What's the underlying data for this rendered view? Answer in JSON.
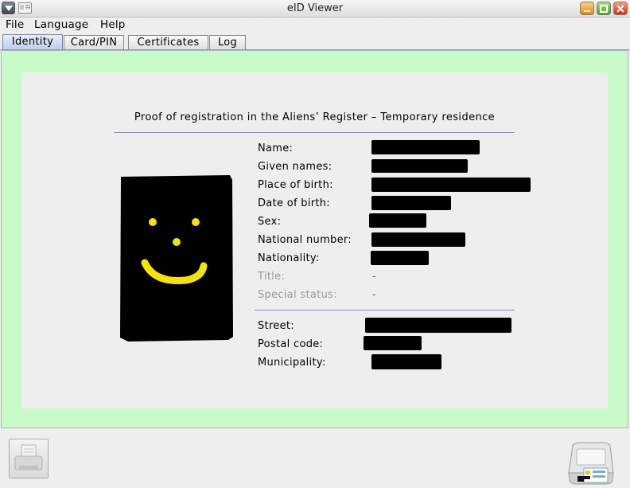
{
  "window": {
    "title": "eID Viewer"
  },
  "menu": {
    "file": "File",
    "language": "Language",
    "help": "Help"
  },
  "tabs": {
    "identity": "Identity",
    "card_pin": "Card/PIN",
    "certificates": "Certificates",
    "log": "Log"
  },
  "document": {
    "title": "Proof of registration in the Aliens’ Register – Temporary residence"
  },
  "fields": {
    "name": "Name:",
    "given_names": "Given names:",
    "place_of_birth": "Place of birth:",
    "date_of_birth": "Date of birth:",
    "sex": "Sex:",
    "national_number": "National number:",
    "nationality": "Nationality:",
    "title": "Title:",
    "special_status": "Special status:",
    "street": "Street:",
    "postal_code": "Postal code:",
    "municipality": "Municipality:"
  },
  "values": {
    "title": "-",
    "special_status": "-"
  },
  "icons": {
    "system_menu": "chevron-down-icon",
    "app": "eid-card-icon",
    "print": "printer-icon",
    "reader": "card-reader-icon"
  },
  "colors": {
    "content_border": "#c9fbc9",
    "panel_bg": "#eeeeee",
    "separator": "#7b8fc1"
  }
}
